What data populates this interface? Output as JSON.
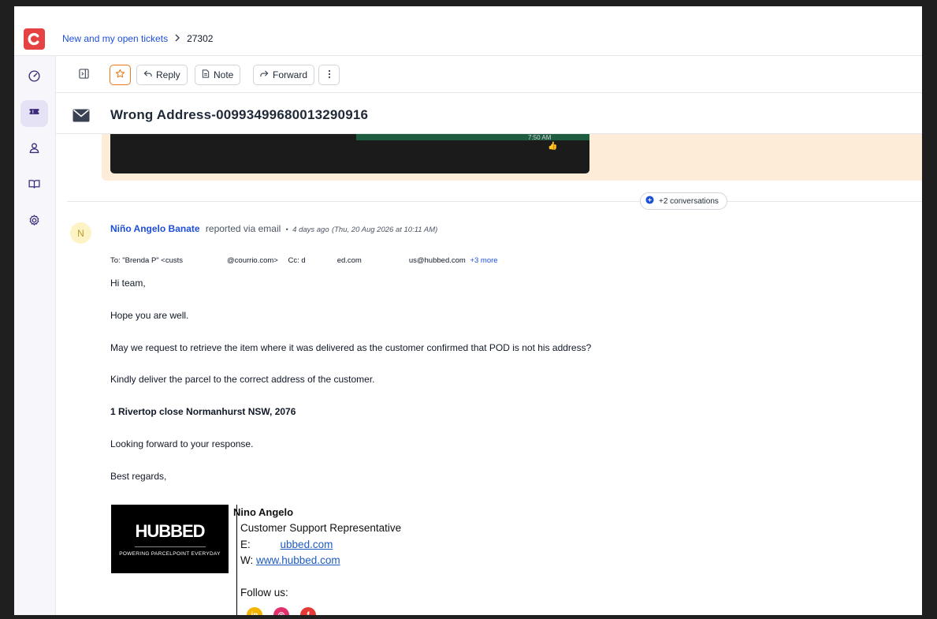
{
  "breadcrumb": {
    "parent": "New and my open tickets",
    "ticket_id": "27302"
  },
  "toolbar": {
    "reply_label": "Reply",
    "note_label": "Note",
    "forward_label": "Forward"
  },
  "ticket": {
    "title": "Wrong Address-00993499680013290916"
  },
  "previous_message": {
    "image_time": "7:50 AM",
    "image_emoji": "👍"
  },
  "conversations": {
    "label": "+2 conversations"
  },
  "message": {
    "avatar_initial": "N",
    "sender": "Niño Angelo Banate",
    "via": "reported via email",
    "separator": "•",
    "relative_time": "4 days ago",
    "absolute_time": "(Thu, 20 Aug 2026 at 10:11 AM)",
    "to_prefix": "To: \"Brenda P\" <custs",
    "to_suffix": "@courrio.com>",
    "cc_prefix": "Cc: d",
    "cc_part": "ed.com",
    "cc_tail": "us@hubbed.com",
    "more_recipients": "+3 more",
    "body": [
      {
        "text": "Hi team,",
        "bold": false
      },
      {
        "text": "Hope you are well.",
        "bold": false
      },
      {
        "text": "May we request to retrieve the item where it was delivered as the customer confirmed that POD is not his address?",
        "bold": false
      },
      {
        "text": "Kindly deliver the parcel to the correct address of the customer.",
        "bold": false
      },
      {
        "text": "1 Rivertop close Normanhurst NSW, 2076",
        "bold": true
      },
      {
        "text": "Looking forward to your response.",
        "bold": false
      },
      {
        "text": "Best regards,",
        "bold": false
      }
    ]
  },
  "signature": {
    "logo_brand": "HUBBED",
    "logo_tagline": "POWERING PARCELPOINT EVERYDAY",
    "name": "Nino Angelo",
    "role": "Customer Support Representative",
    "email_prefix": "E:",
    "email_visible": "ubbed.com",
    "web_prefix": "W:",
    "website": "www.hubbed.com",
    "follow_label": "Follow us:",
    "socials": [
      {
        "name": "linkedin",
        "glyph": "in",
        "color": "#f5b400"
      },
      {
        "name": "instagram",
        "glyph": "◎",
        "color": "#e1306c"
      },
      {
        "name": "facebook",
        "glyph": "f",
        "color": "#e53935"
      }
    ]
  },
  "colors": {
    "accent": "#1d4ed8",
    "brand": "#e54343",
    "nav_active": "#e6e2f6",
    "star": "#ea7a1b",
    "previous_bg": "#fdecd8"
  }
}
